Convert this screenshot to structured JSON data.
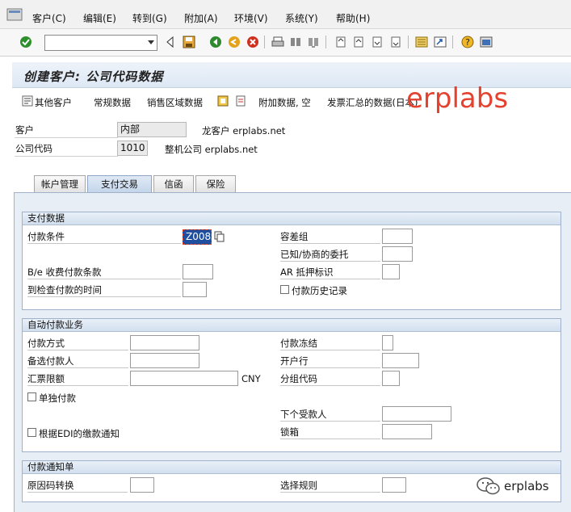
{
  "menu": [
    "客户(C)",
    "编辑(E)",
    "转到(G)",
    "附加(A)",
    "环境(V)",
    "系统(Y)",
    "帮助(H)"
  ],
  "toolbar": {
    "command_value": ""
  },
  "title": "创建客户: 公司代码数据",
  "app_toolbar": {
    "other_customer": "其他客户",
    "general_data": "常规数据",
    "sales_area_data": "销售区域数据",
    "additional_data": "附加数据, 空",
    "invoice_summary": "发票汇总的数据(日本)"
  },
  "watermark": "erplabs",
  "header": {
    "customer_label": "客户",
    "customer_value": "内部",
    "customer_desc": "龙客户 erplabs.net",
    "company_label": "公司代码",
    "company_value": "1010",
    "company_desc": "整机公司 erplabs.net"
  },
  "tabs": [
    "帐户管理",
    "支付交易",
    "信函",
    "保险"
  ],
  "payment_data": {
    "title": "支付数据",
    "terms_label": "付款条件",
    "terms_value": "Z008",
    "tolerance_label": "容差组",
    "known_mandate_label": "已知/协商的委托",
    "be_terms_label": "B/e 收费付款条款",
    "ar_pledge_label": "AR 抵押标识",
    "check_time_label": "到检查付款的时间",
    "history_label": "付款历史记录"
  },
  "auto_payment": {
    "title": "自动付款业务",
    "methods_label": "付款方式",
    "block_label": "付款冻结",
    "alt_payer_label": "备选付款人",
    "house_bank_label": "开户行",
    "bill_limit_label": "汇票限额",
    "currency": "CNY",
    "grouping_label": "分组代码",
    "single_label": "单独付款",
    "next_payee_label": "下个受款人",
    "edi_label": "根据EDI的缴款通知",
    "lockbox_label": "锁箱"
  },
  "payment_advice": {
    "title": "付款通知单",
    "reason_label": "原因码转换",
    "selection_label": "选择规则"
  },
  "wechat_brand": "erplabs",
  "colors": {
    "accent": "#e5412f",
    "panel": "#e8eef5",
    "header": "#d2dfee"
  }
}
